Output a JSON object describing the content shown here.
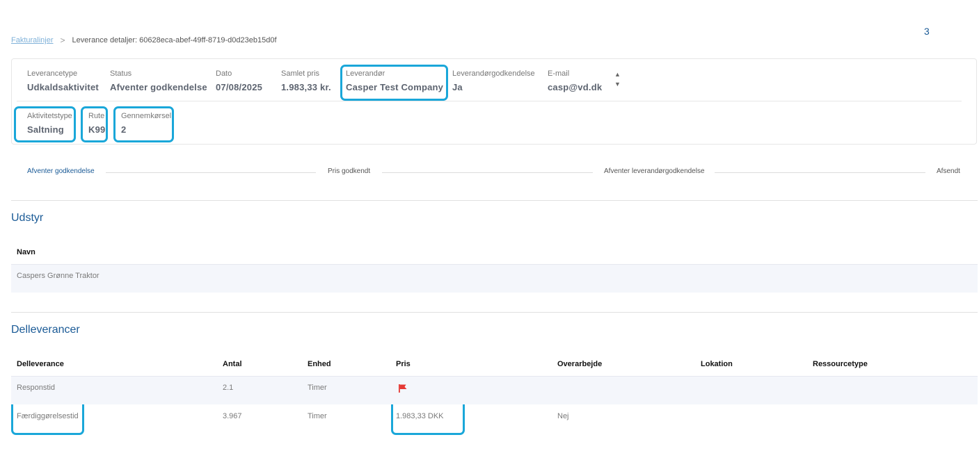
{
  "page_number": "3",
  "breadcrumb": {
    "link": "Fakturalinjer",
    "separator": ">",
    "current": "Leverance detaljer: 60628eca-abef-49ff-8719-d0d23eb15d0f"
  },
  "details": {
    "leverancetype": {
      "label": "Leverancetype",
      "value": "Udkaldsaktivitet"
    },
    "status": {
      "label": "Status",
      "value": "Afventer godkendelse"
    },
    "dato": {
      "label": "Dato",
      "value": "07/08/2025"
    },
    "samlet_pris": {
      "label": "Samlet pris",
      "value": "1.983,33 kr."
    },
    "leverandor": {
      "label": "Leverandør",
      "value": "Casper Test Company"
    },
    "leverandorgodkendelse": {
      "label": "Leverandørgodkendelse",
      "value": "Ja"
    },
    "email": {
      "label": "E-mail",
      "value": "casp@vd.dk"
    },
    "aktivitetstype": {
      "label": "Aktivitetstype",
      "value": "Saltning"
    },
    "rute": {
      "label": "Rute",
      "value": "K99"
    },
    "gennemkorsel": {
      "label": "Gennemkørsel",
      "value": "2"
    },
    "sorter": {
      "up": "▲",
      "down": "▼"
    }
  },
  "steps": [
    "Afventer godkendelse",
    "Pris godkendt",
    "Afventer leverandørgodkendelse",
    "Afsendt"
  ],
  "udstyr": {
    "title": "Udstyr",
    "header": "Navn",
    "rows": [
      "Caspers Grønne Traktor"
    ]
  },
  "delleverancer": {
    "title": "Delleverancer",
    "headers": [
      "Delleverance",
      "Antal",
      "Enhed",
      "Pris",
      "Overarbejde",
      "Lokation",
      "Ressourcetype"
    ],
    "rows": [
      {
        "delleverance": "Responstid",
        "antal": "2.1",
        "enhed": "Timer",
        "pris": "",
        "pris_icon": "flag-icon",
        "overarbejde": "",
        "lokation": "",
        "ressourcetype": ""
      },
      {
        "delleverance": "Færdiggørelsestid",
        "antal": "3.967",
        "enhed": "Timer",
        "pris": "1.983,33 DKK",
        "overarbejde": "Nej",
        "lokation": "",
        "ressourcetype": ""
      }
    ]
  },
  "colors": {
    "accent": "#1a5a96",
    "highlight": "#1aa7d9",
    "flag": "#e53935"
  }
}
